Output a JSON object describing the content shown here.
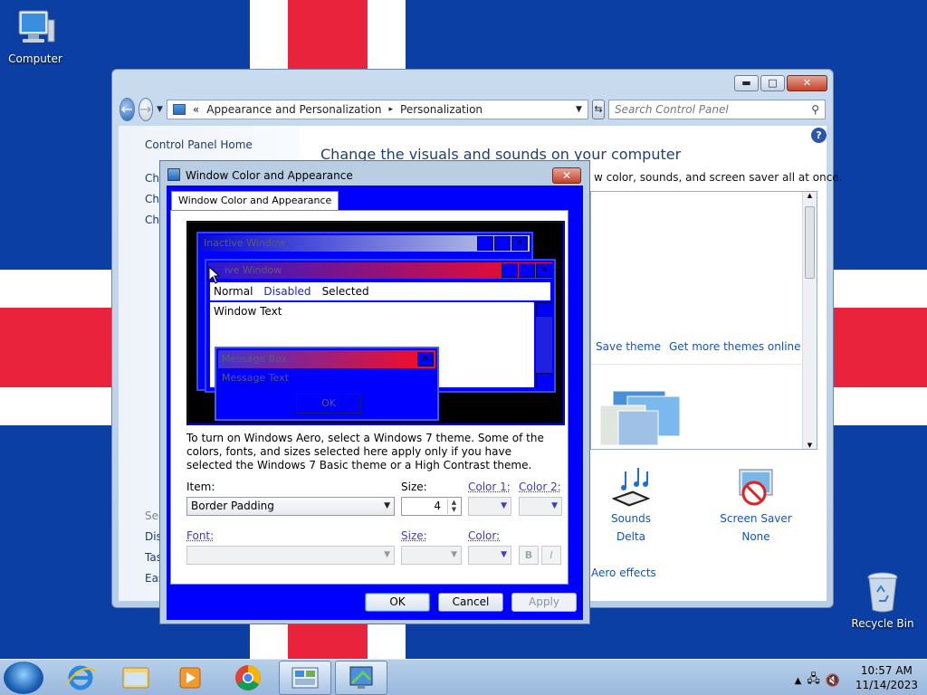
{
  "desktop": {
    "icons": [
      {
        "label": "Computer"
      },
      {
        "label": "Recycle Bin"
      }
    ]
  },
  "control_panel": {
    "breadcrumb": {
      "prefix": "«",
      "part1": "Appearance and Personalization",
      "sep": "▸",
      "part2": "Personalization"
    },
    "search_placeholder": "Search Control Panel",
    "left": {
      "home": "Control Panel Home",
      "frags": [
        "Ch",
        "Ch",
        "Ch"
      ],
      "see_also_frag": "See",
      "see_frags": [
        "Dis",
        "Tas",
        "Eas"
      ]
    },
    "title": "Change the visuals and sounds on your computer",
    "subtitle": "w color, sounds, and screen saver all at once.",
    "save_theme": "Save theme",
    "get_more": "Get more themes online",
    "sounds": {
      "label": "Sounds",
      "value": "Delta"
    },
    "screensaver": {
      "label": "Screen Saver",
      "value": "None"
    },
    "aero": "Aero effects"
  },
  "dialog": {
    "title": "Window Color and Appearance",
    "tab": "Window Color and Appearance",
    "preview": {
      "inactive": "Inactive Window",
      "active": "ive Window",
      "menu": [
        "Normal",
        "Disabled",
        "Selected"
      ],
      "window_text": "Window Text",
      "msg_title": "Message Box",
      "msg_text": "Message Text",
      "ok": "OK"
    },
    "info": "To turn on Windows Aero, select a Windows 7 theme.  Some of the colors, fonts, and sizes selected here apply only if you have selected the Windows 7 Basic theme or a High Contrast theme.",
    "item_label": "Item:",
    "item_value": "Border Padding",
    "size_label": "Size:",
    "size_value": "4",
    "color1_label": "Color 1:",
    "color2_label": "Color 2:",
    "font_label": "Font:",
    "font_size_label": "Size:",
    "font_color_label": "Color:",
    "bold": "B",
    "italic": "I",
    "buttons": {
      "ok": "OK",
      "cancel": "Cancel",
      "apply": "Apply"
    }
  },
  "taskbar": {
    "time": "10:57 AM",
    "date": "11/14/2023"
  },
  "colors": {
    "wallpaper_blue": "#0b3fa4",
    "flag_red": "#e8233b",
    "dialog_blue": "#0000ff"
  }
}
